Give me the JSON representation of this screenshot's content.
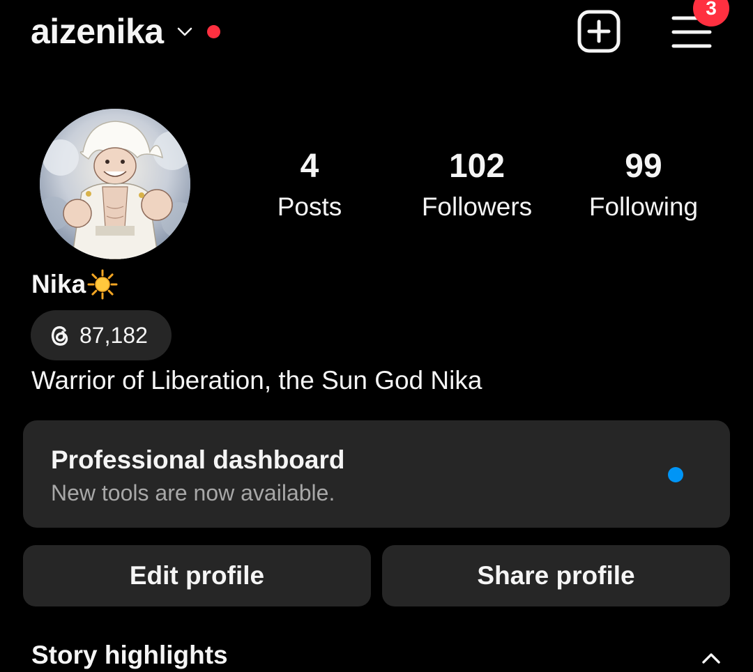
{
  "header": {
    "username": "aizenika",
    "notification_badge": "3",
    "icons": {
      "account_switcher": "chevron-down-icon",
      "new_post": "plus-square-icon",
      "menu": "hamburger-menu-icon"
    }
  },
  "profile": {
    "stats": [
      {
        "value": "4",
        "label": "Posts"
      },
      {
        "value": "102",
        "label": "Followers"
      },
      {
        "value": "99",
        "label": "Following"
      }
    ],
    "display_name": "Nika",
    "display_name_emoji": "sun-emoji",
    "threads_count": "87,182",
    "bio": "Warrior of Liberation, the Sun God Nika"
  },
  "dashboard": {
    "title": "Professional dashboard",
    "subtitle": "New tools are now available."
  },
  "actions": {
    "edit_label": "Edit profile",
    "share_label": "Share profile"
  },
  "highlights": {
    "title": "Story highlights"
  },
  "colors": {
    "background": "#000000",
    "surface": "#262626",
    "text": "#f5f5f5",
    "secondary_text": "#a8a8a8",
    "notification_red": "#ff3040",
    "accent_blue": "#0095f6"
  }
}
